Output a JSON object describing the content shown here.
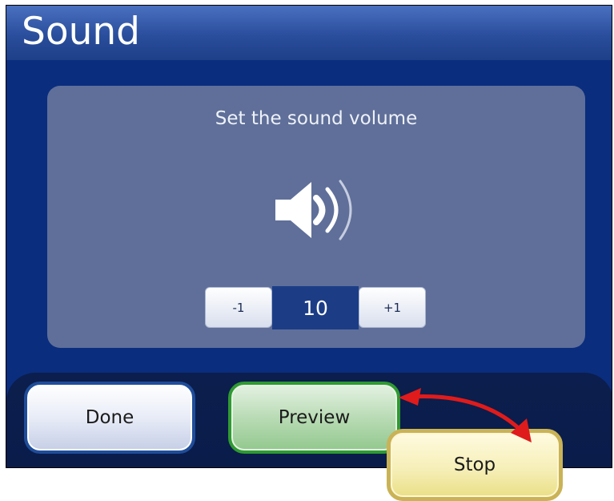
{
  "window": {
    "title": "Sound"
  },
  "panel": {
    "prompt": "Set the sound volume"
  },
  "stepper": {
    "minus_label": "-1",
    "value": "10",
    "plus_label": "+1"
  },
  "buttons": {
    "done": "Done",
    "preview": "Preview",
    "stop": "Stop"
  },
  "icons": {
    "speaker": "speaker-volume-icon",
    "arrow": "double-headed-arrow-icon"
  },
  "colors": {
    "background": "#0a2d7e",
    "title_bar": "#2a4e9c",
    "panel": "#5f6f99",
    "done_border": "#1f4d9a",
    "preview_border": "#2f9a32",
    "stop_border": "#c9b356",
    "arrow": "#e01b1b"
  }
}
